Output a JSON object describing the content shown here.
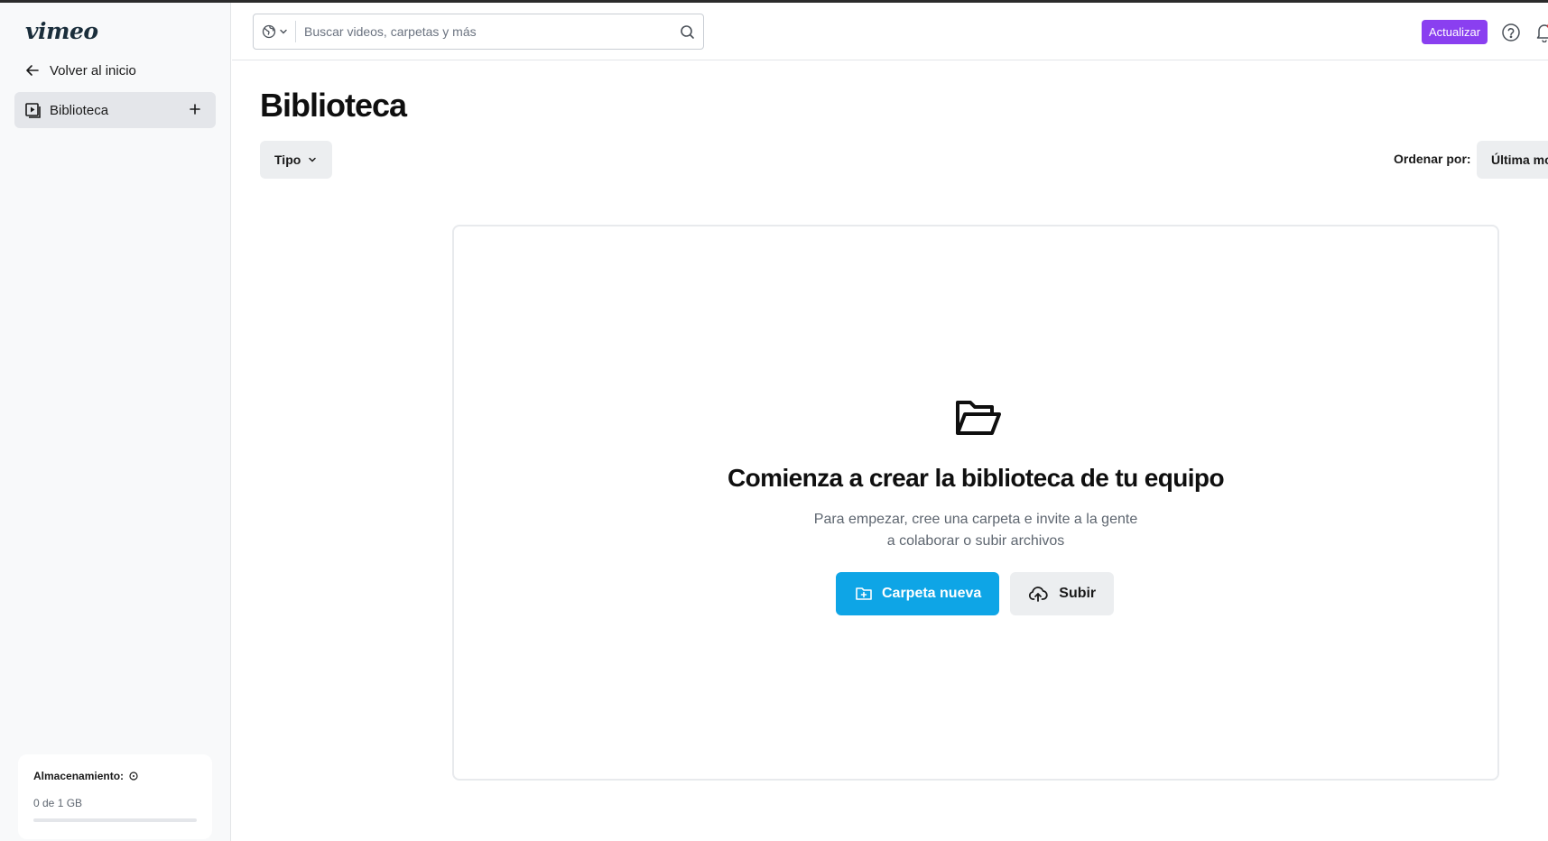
{
  "colors": {
    "accent": "#0ea5e6",
    "upgrade": "#8a3ff0",
    "sidebar_bg": "#f8f9fa",
    "active_item_bg": "#e4e6ea"
  },
  "sidebar": {
    "logo": "vimeo",
    "back_label": "Volver al inicio",
    "library_label": "Biblioteca",
    "storage": {
      "title": "Almacenamiento:",
      "value": "0 de 1 GB",
      "used_fraction": 0
    }
  },
  "header": {
    "search_placeholder": "Buscar videos, carpetas y más",
    "upgrade_label": "Actualizar"
  },
  "main": {
    "title": "Biblioteca",
    "type_filter_label": "Tipo",
    "sort_label": "Ordenar por:",
    "sort_value": "Última modificación",
    "empty": {
      "title": "Comienza a crear la biblioteca de tu equipo",
      "desc_line1": "Para empezar, cree una carpeta e invite a la gente",
      "desc_line2": "a colaborar o subir archivos",
      "new_folder_label": "Carpeta nueva",
      "upload_label": "Subir"
    }
  },
  "icons": [
    "arrow-left-icon",
    "library-icon",
    "plus-icon",
    "info-icon",
    "globe-icon",
    "chevron-down-icon",
    "search-icon",
    "help-icon",
    "bell-icon",
    "folder-open-icon",
    "folder-plus-icon",
    "cloud-upload-icon"
  ]
}
